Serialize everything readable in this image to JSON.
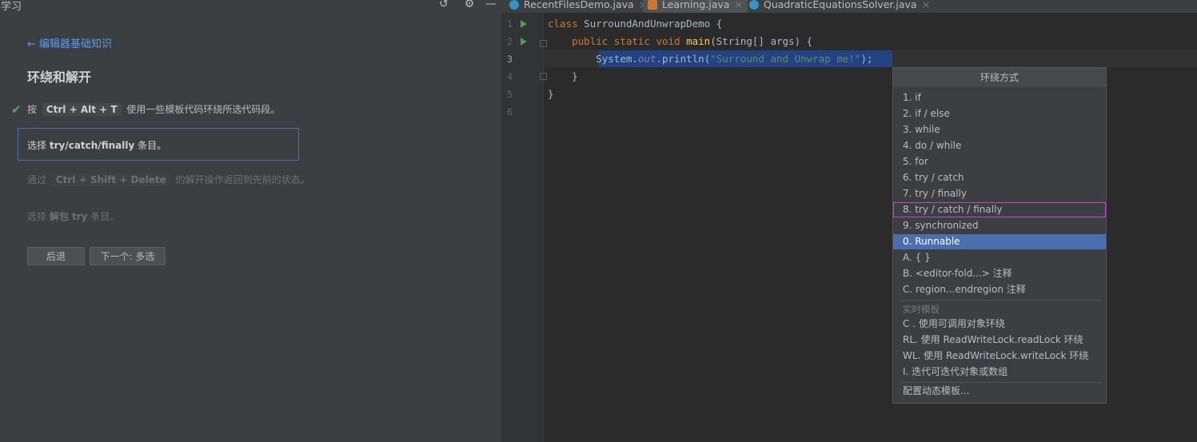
{
  "left_panel": {
    "title": "学习",
    "back_link": "← 编辑器基础知识",
    "lesson_title": "环绕和解开",
    "step1": {
      "pre": "按",
      "keys": "Ctrl + Alt + T",
      "post": "使用一些模板代码环绕所选代码段。"
    },
    "task": {
      "pre": "选择",
      "bold": "try/catch/finally",
      "post": "条目。"
    },
    "step3": {
      "pre": "通过",
      "keys": "Ctrl + Shift + Delete",
      "post": "的解开操作返回到先前的状态。"
    },
    "step4": {
      "pre": "选择",
      "bold": "解包 try",
      "post": "条目。"
    },
    "buttons": {
      "back": "后退",
      "next": "下一个: 多选"
    }
  },
  "tabs": [
    {
      "label": "RecentFilesDemo.java",
      "active": false
    },
    {
      "label": "Learning.java",
      "active": true
    },
    {
      "label": "QuadraticEquationsSolver.java",
      "active": false
    }
  ],
  "editor": {
    "line_numbers": [
      "1",
      "2",
      "3",
      "4",
      "5",
      "6"
    ],
    "lines": {
      "l1": {
        "kw": "class",
        "rest": " SurroundAndUnwrapDemo {"
      },
      "l2": {
        "kw": "public static void",
        "fn": "main",
        "rest": "(String[] args) {"
      },
      "l3": {
        "a": "System.",
        "b": "out",
        "c": ".println(",
        "s": "\"Surround and Unwrap me!\"",
        "d": ");"
      },
      "l4": "}",
      "l5": "}"
    }
  },
  "popup": {
    "title": "环绕方式",
    "items": [
      "1. if",
      "2. if / else",
      "3. while",
      "4. do / while",
      "5. for",
      "6. try / catch",
      "7. try / finally",
      "8. try / catch / finally",
      "9. synchronized",
      "0. Runnable",
      "A. { }",
      "B. <editor-fold...> 注释",
      "C. region...endregion 注释"
    ],
    "group_label": "实时模板",
    "templates": [
      "C . 使用可调用对象环绕",
      "RL. 使用 ReadWriteLock.readLock 环绕",
      "WL. 使用 ReadWriteLock.writeLock 环绕",
      "I. 迭代可迭代对象或数组"
    ],
    "configure": "配置动态模板..."
  },
  "colors": {
    "selection": "#214283",
    "accent": "#4b6eaf",
    "highlight_border": "#c24bc6"
  },
  "icons": [
    "undo-icon",
    "gear-icon",
    "minimize-icon",
    "check-icon",
    "run-icon",
    "fold-icon",
    "java-class-icon",
    "close-icon"
  ]
}
